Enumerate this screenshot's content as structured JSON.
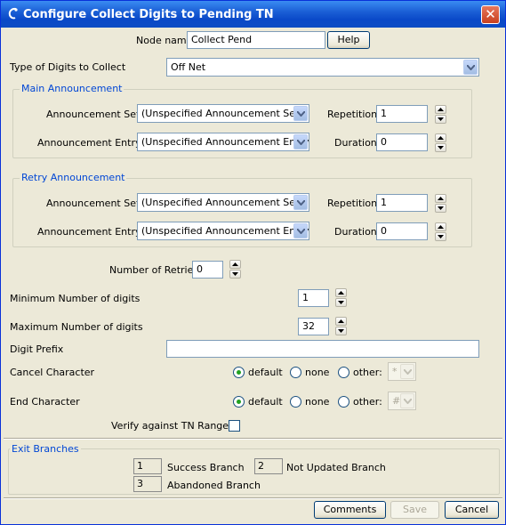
{
  "window": {
    "title": "Configure Collect Digits to Pending TN",
    "close_glyph": "✕"
  },
  "node": {
    "label": "Node name",
    "value": "Collect Pend",
    "help_label": "Help"
  },
  "digits_type": {
    "label": "Type of Digits to Collect",
    "value": "Off Net"
  },
  "main_announcement": {
    "title": "Main Announcement",
    "set_label": "Announcement Set",
    "set_value": "(Unspecified Announcement Set)",
    "entry_label": "Announcement Entry",
    "entry_value": "(Unspecified Announcement Entry)",
    "repetition_label": "Repetition",
    "repetition_value": "1",
    "duration_label": "Duration",
    "duration_value": "0"
  },
  "retry_announcement": {
    "title": "Retry Announcement",
    "set_label": "Announcement Set",
    "set_value": "(Unspecified Announcement Set)",
    "entry_label": "Announcement Entry",
    "entry_value": "(Unspecified Announcement Entry)",
    "repetition_label": "Repetition",
    "repetition_value": "1",
    "duration_label": "Duration",
    "duration_value": "0"
  },
  "retries": {
    "label": "Number of Retries",
    "value": "0"
  },
  "min_digits": {
    "label": "Minimum Number of digits",
    "value": "1"
  },
  "max_digits": {
    "label": "Maximum Number of digits",
    "value": "32"
  },
  "digit_prefix": {
    "label": "Digit Prefix",
    "value": ""
  },
  "cancel_char": {
    "label": "Cancel Character",
    "options": [
      "default",
      "none",
      "other:"
    ],
    "selected": "default",
    "other_value": "*"
  },
  "end_char": {
    "label": "End Character",
    "options": [
      "default",
      "none",
      "other:"
    ],
    "selected": "default",
    "other_value": "#"
  },
  "verify": {
    "label": "Verify against TN Ranges?",
    "checked": false
  },
  "exit_branches": {
    "title": "Exit Branches",
    "items": [
      {
        "num": "1",
        "label": "Success Branch"
      },
      {
        "num": "2",
        "label": "Not Updated Branch"
      },
      {
        "num": "3",
        "label": "Abandoned Branch"
      }
    ]
  },
  "footer": {
    "comments_label": "Comments",
    "save_label": "Save",
    "cancel_label": "Cancel"
  }
}
